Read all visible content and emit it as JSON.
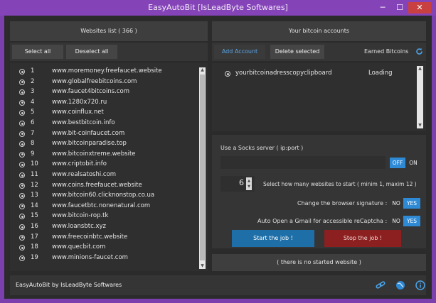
{
  "window": {
    "title": "EasyAutoBit [IsLeadByte Softwares]",
    "min_glyph": "─",
    "max_glyph": "☐",
    "close_glyph": "✕"
  },
  "websites": {
    "header": "Websites list ( 366 )",
    "select_all": "Select all",
    "deselect_all": "Deselect all",
    "items": [
      {
        "num": "1",
        "url": "www.moremoney.freefaucet.website"
      },
      {
        "num": "2",
        "url": "www.globalfreebitcoins.com"
      },
      {
        "num": "3",
        "url": "www.faucet4bitcoins.com"
      },
      {
        "num": "4",
        "url": "www.1280x720.ru"
      },
      {
        "num": "5",
        "url": "www.coinflux.net"
      },
      {
        "num": "6",
        "url": "www.bestbitcoin.info"
      },
      {
        "num": "7",
        "url": "www.bit-coinfaucet.com"
      },
      {
        "num": "8",
        "url": "www.bitcoinparadise.top"
      },
      {
        "num": "9",
        "url": "www.bitcoinxtreme.website"
      },
      {
        "num": "10",
        "url": "www.criptobit.info"
      },
      {
        "num": "11",
        "url": "www.realsatoshi.com"
      },
      {
        "num": "12",
        "url": "www.coins.freefaucet.website"
      },
      {
        "num": "13",
        "url": "www.bitcoin60.clicknonstop.co.ua"
      },
      {
        "num": "14",
        "url": "www.faucetbtc.nonenatural.com"
      },
      {
        "num": "15",
        "url": "www.bitcoin-rop.tk"
      },
      {
        "num": "16",
        "url": "www.loansbtc.xyz"
      },
      {
        "num": "17",
        "url": "www.freecoinbtc.website"
      },
      {
        "num": "18",
        "url": "www.quecbit.com"
      },
      {
        "num": "19",
        "url": "www.minions-faucet.com"
      }
    ]
  },
  "accounts": {
    "header": "Your bitcoin accounts",
    "add_account": "Add Account",
    "delete_selected": "Delete selected",
    "earned_label": "Earned Bitcoins",
    "items": [
      {
        "address": "yourbitcoinadresscopyclipboard",
        "status": "Loading"
      }
    ]
  },
  "settings": {
    "socks_label": "Use a Socks server ( ip:port )",
    "socks_value": "",
    "toggle_off": "OFF",
    "toggle_on": "ON",
    "websites_count": "6",
    "websites_count_label": "Select how many websites to start ( minim 1, maxim 12 )",
    "signature_label": "Change the browser signature :",
    "gmail_label": "Auto Open a Gmail for accessible reCaptcha :",
    "no": "NO",
    "yes": "YES"
  },
  "actions": {
    "start": "Start the job !",
    "stop": "Stop the job !"
  },
  "status": {
    "started": "( there is no started website )"
  },
  "footer": {
    "brand": "EasyAutoBit by IsLeadByte Softwares"
  },
  "colors": {
    "frame": "#7b3fae",
    "accent": "#2f8ad6",
    "start": "#1e6fa8",
    "stop": "#8c1f1f"
  }
}
